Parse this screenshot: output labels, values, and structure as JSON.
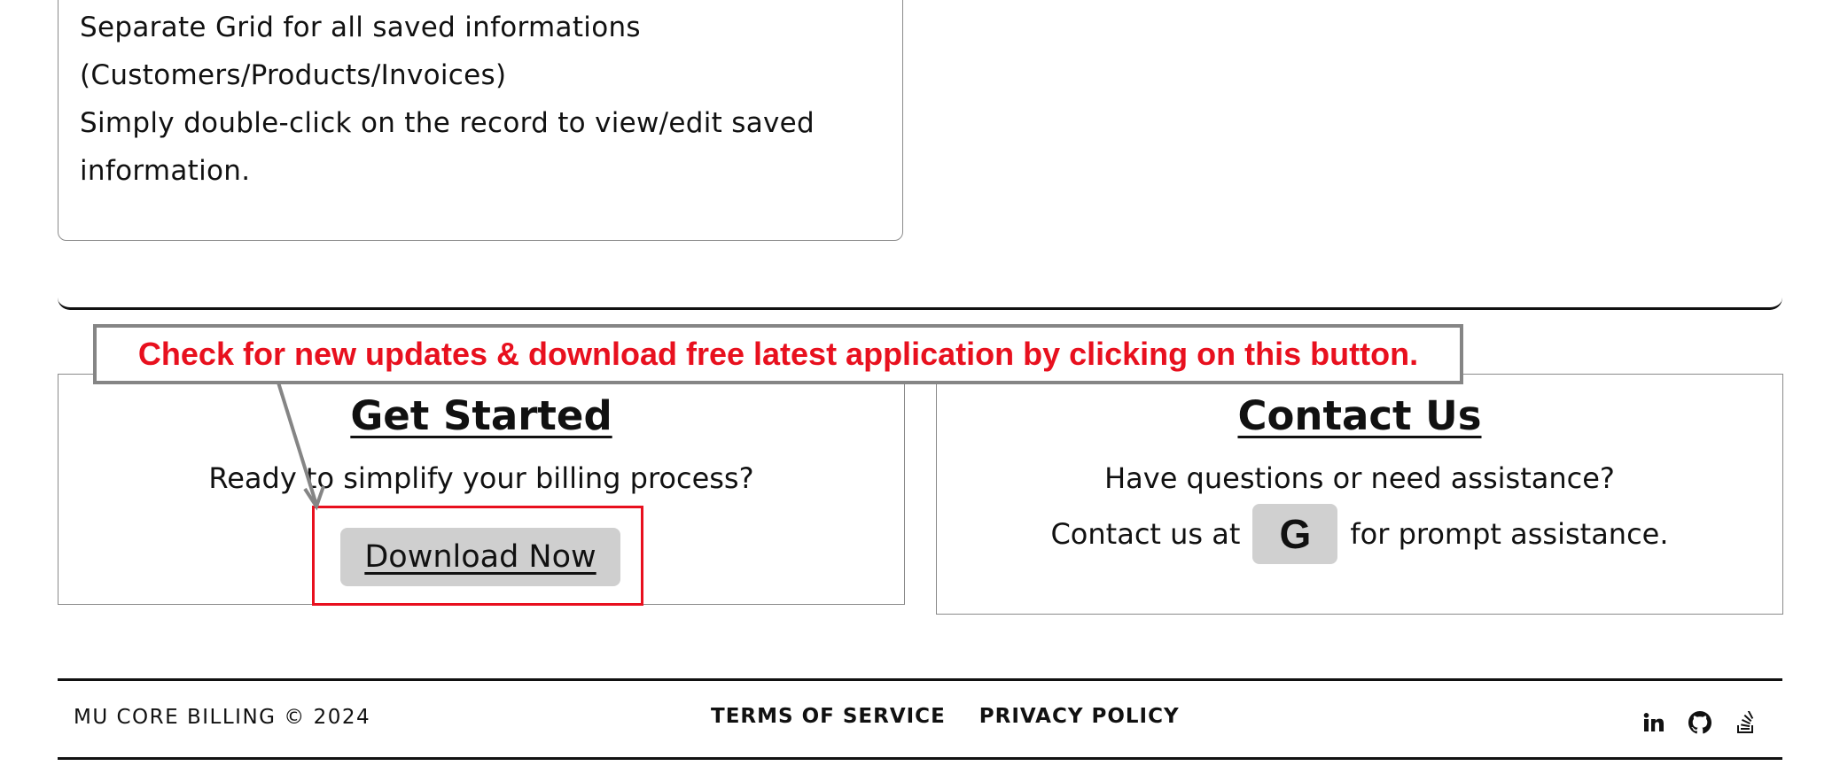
{
  "features": {
    "lines": [
      "Separate Grid for all saved informations",
      "(Customers/Products/Invoices)",
      "Simply double-click on the record to view/edit saved",
      "information."
    ]
  },
  "annotation": {
    "text": "Check for new updates & download free latest application by clicking on this button.",
    "color": "#e8101e"
  },
  "get_started": {
    "heading": "Get Started",
    "subtext": "Ready to simplify your billing process?",
    "button_label": "Download Now"
  },
  "contact": {
    "heading": "Contact Us",
    "line1": "Have questions or need assistance?",
    "prefix": "Contact us at",
    "google_label": "G",
    "suffix": "for prompt assistance."
  },
  "footer": {
    "copyright": "MU CORE BILLING © 2024",
    "links": [
      "TERMS OF SERVICE",
      "PRIVACY POLICY"
    ],
    "social_icons": [
      "linkedin-icon",
      "github-icon",
      "stackoverflow-icon"
    ]
  }
}
